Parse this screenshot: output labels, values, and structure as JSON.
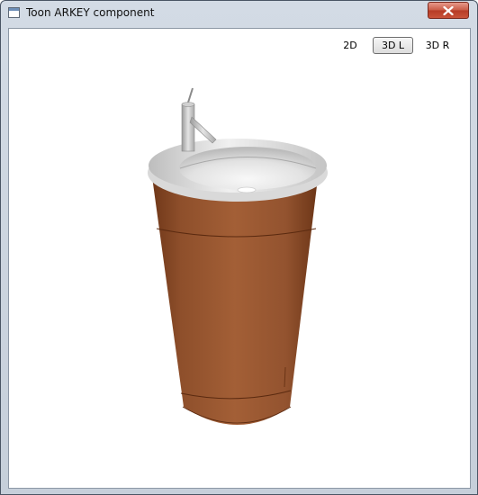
{
  "window": {
    "title": "Toon ARKEY component",
    "icon": "app-window-icon",
    "close_icon": "close-icon"
  },
  "view_modes": [
    {
      "label": "2D",
      "active": false
    },
    {
      "label": "3D L",
      "active": true
    },
    {
      "label": "3D R",
      "active": false
    }
  ],
  "model": {
    "name": "washbasin-pedestal",
    "pedestal_color": "#8a4a26",
    "basin_color": "#d9d9d9",
    "faucet_color": "#bdbdbd"
  }
}
